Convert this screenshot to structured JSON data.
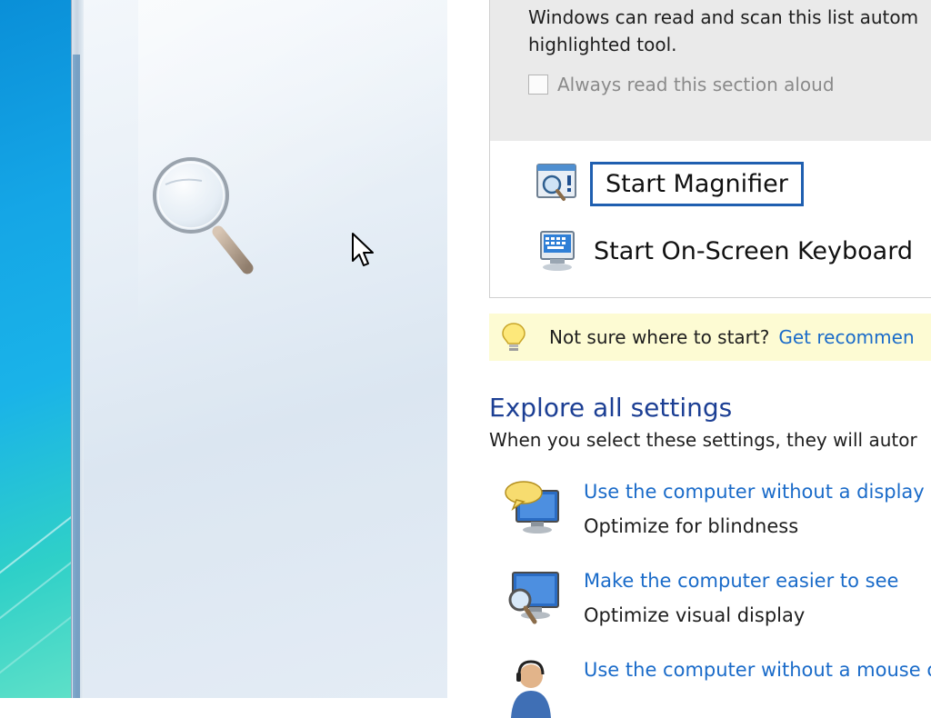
{
  "read_section": {
    "text_line1": "Windows can read and scan this list autom",
    "text_line2": "highlighted tool.",
    "checkbox_label": "Always read this section aloud",
    "checkbox_checked": false
  },
  "tools": [
    {
      "label": "Start Magnifier",
      "icon": "magnifier-tool-icon",
      "focused": true
    },
    {
      "label": "Start On-Screen Keyboard",
      "icon": "keyboard-tool-icon",
      "focused": false
    }
  ],
  "tip": {
    "text": "Not sure where to start?",
    "link": "Get recommen"
  },
  "explore": {
    "title": "Explore all settings",
    "subtitle": "When you select these settings, they will autor"
  },
  "settings": [
    {
      "link": "Use the computer without a display",
      "desc": "Optimize for blindness",
      "icon": "speech-monitor-icon"
    },
    {
      "link": "Make the computer easier to see",
      "desc": "Optimize visual display",
      "icon": "magnify-monitor-icon"
    },
    {
      "link": "Use the computer without a mouse o",
      "desc": "",
      "icon": "headset-person-icon"
    }
  ],
  "colors": {
    "link": "#1a6bc9",
    "heading": "#1c3f94",
    "focus_border": "#1f5fb0",
    "tip_background": "#fdfbd3"
  }
}
